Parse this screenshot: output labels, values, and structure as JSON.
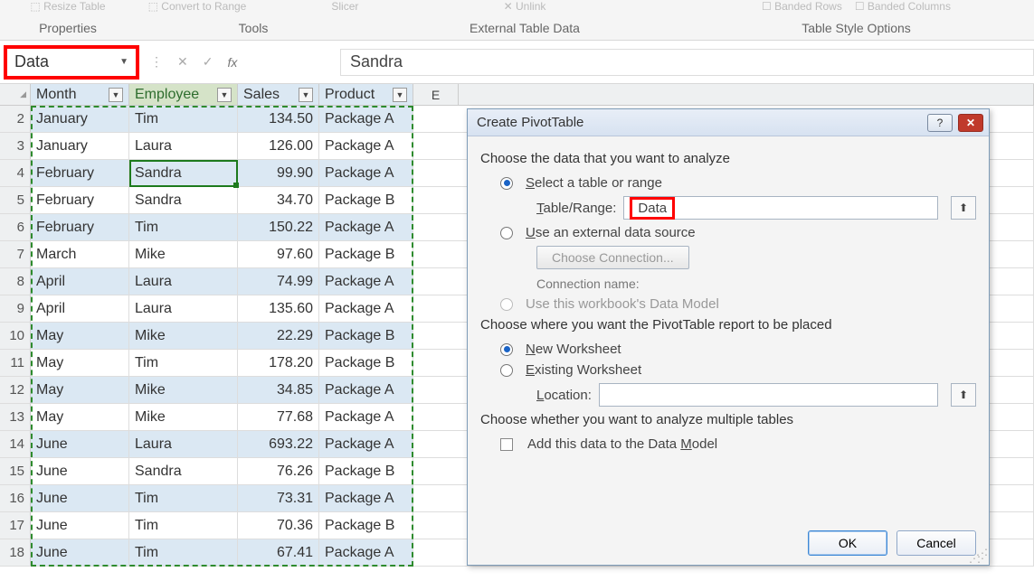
{
  "ribbon": {
    "resize_label": "Resize Table",
    "properties_label": "Properties",
    "convert_label": "Convert to Range",
    "slicer_label": "Slicer",
    "tools_label": "Tools",
    "unlink_label": "Unlink",
    "external_label": "External Table Data",
    "banded_rows": "Banded Rows",
    "banded_cols": "Banded Columns",
    "options_label": "Table Style Options"
  },
  "namebox": {
    "value": "Data"
  },
  "formula": {
    "value": "Sandra"
  },
  "columns": [
    "Month",
    "Employee",
    "Sales",
    "Product"
  ],
  "col_letter_e": "E",
  "rows": [
    {
      "n": "2",
      "month": "January",
      "emp": "Tim",
      "sales": "134.50",
      "prod": "Package A"
    },
    {
      "n": "3",
      "month": "January",
      "emp": "Laura",
      "sales": "126.00",
      "prod": "Package A"
    },
    {
      "n": "4",
      "month": "February",
      "emp": "Sandra",
      "sales": "99.90",
      "prod": "Package A"
    },
    {
      "n": "5",
      "month": "February",
      "emp": "Sandra",
      "sales": "34.70",
      "prod": "Package B"
    },
    {
      "n": "6",
      "month": "February",
      "emp": "Tim",
      "sales": "150.22",
      "prod": "Package A"
    },
    {
      "n": "7",
      "month": "March",
      "emp": "Mike",
      "sales": "97.60",
      "prod": "Package B"
    },
    {
      "n": "8",
      "month": "April",
      "emp": "Laura",
      "sales": "74.99",
      "prod": "Package A"
    },
    {
      "n": "9",
      "month": "April",
      "emp": "Laura",
      "sales": "135.60",
      "prod": "Package A"
    },
    {
      "n": "10",
      "month": "May",
      "emp": "Mike",
      "sales": "22.29",
      "prod": "Package B"
    },
    {
      "n": "11",
      "month": "May",
      "emp": "Tim",
      "sales": "178.20",
      "prod": "Package B"
    },
    {
      "n": "12",
      "month": "May",
      "emp": "Mike",
      "sales": "34.85",
      "prod": "Package A"
    },
    {
      "n": "13",
      "month": "May",
      "emp": "Mike",
      "sales": "77.68",
      "prod": "Package A"
    },
    {
      "n": "14",
      "month": "June",
      "emp": "Laura",
      "sales": "693.22",
      "prod": "Package A"
    },
    {
      "n": "15",
      "month": "June",
      "emp": "Sandra",
      "sales": "76.26",
      "prod": "Package B"
    },
    {
      "n": "16",
      "month": "June",
      "emp": "Tim",
      "sales": "73.31",
      "prod": "Package A"
    },
    {
      "n": "17",
      "month": "June",
      "emp": "Tim",
      "sales": "70.36",
      "prod": "Package B"
    },
    {
      "n": "18",
      "month": "June",
      "emp": "Tim",
      "sales": "67.41",
      "prod": "Package A"
    }
  ],
  "dialog": {
    "title": "Create PivotTable",
    "choose_data": "Choose the data that you want to analyze",
    "select_table": "Select a table or range",
    "table_range_label": "Table/Range:",
    "table_range_value": "Data",
    "use_external": "Use an external data source",
    "choose_conn": "Choose Connection...",
    "conn_name": "Connection name:",
    "use_model": "Use this workbook's Data Model",
    "choose_where": "Choose where you want the PivotTable report to be placed",
    "new_ws": "New Worksheet",
    "existing_ws": "Existing Worksheet",
    "location_label": "Location:",
    "location_value": "",
    "choose_multi": "Choose whether you want to analyze multiple tables",
    "add_model": "Add this data to the Data Model",
    "ok": "OK",
    "cancel": "Cancel"
  }
}
